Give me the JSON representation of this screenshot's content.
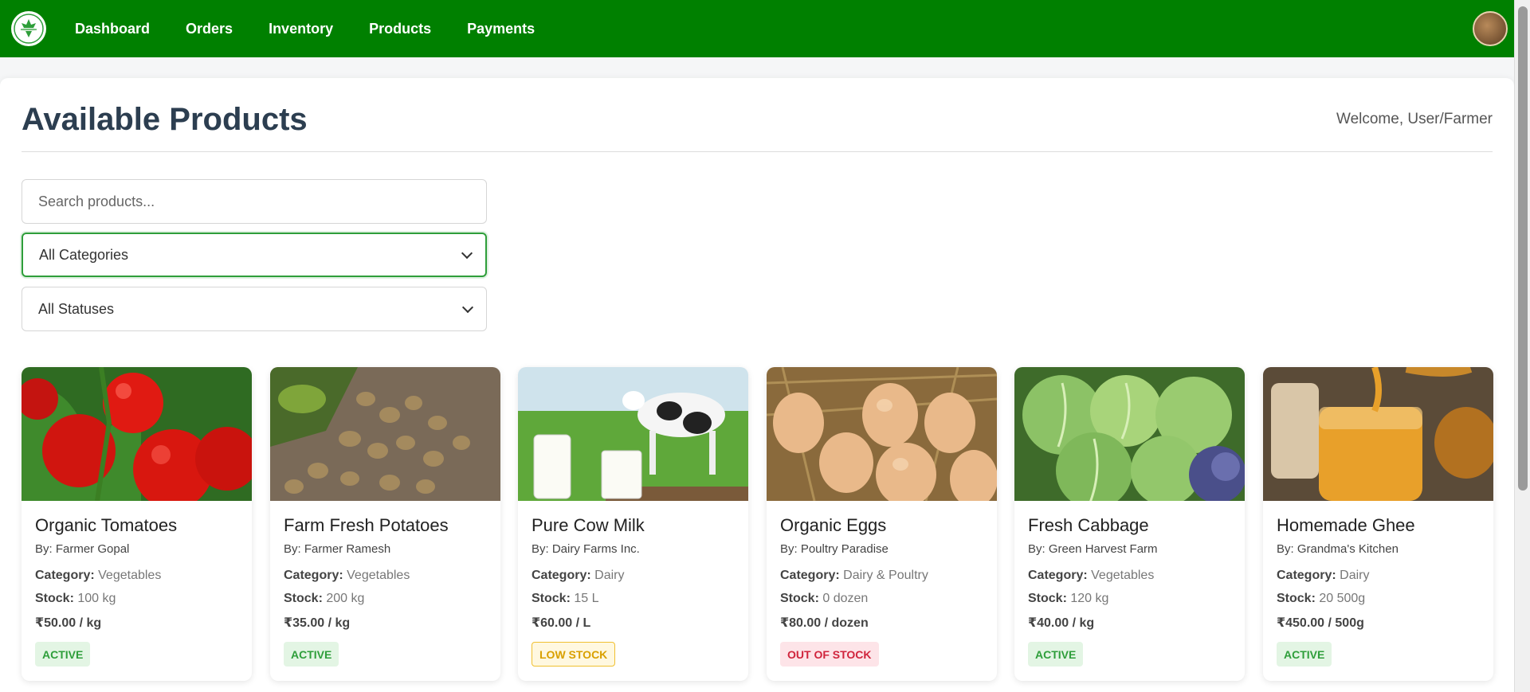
{
  "nav": {
    "items": [
      "Dashboard",
      "Orders",
      "Inventory",
      "Products",
      "Payments"
    ]
  },
  "header": {
    "title": "Available Products",
    "welcome": "Welcome, User/Farmer"
  },
  "filters": {
    "search_placeholder": "Search products...",
    "category_selected": "All Categories",
    "status_selected": "All Statuses"
  },
  "labels": {
    "category": "Category:",
    "stock": "Stock:"
  },
  "products": [
    {
      "name": "Organic Tomatoes",
      "by": "By: Farmer Gopal",
      "category": "Vegetables",
      "stock": "100 kg",
      "price": "₹50.00 / kg",
      "status": "ACTIVE"
    },
    {
      "name": "Farm Fresh Potatoes",
      "by": "By: Farmer Ramesh",
      "category": "Vegetables",
      "stock": "200 kg",
      "price": "₹35.00 / kg",
      "status": "ACTIVE"
    },
    {
      "name": "Pure Cow Milk",
      "by": "By: Dairy Farms Inc.",
      "category": "Dairy",
      "stock": "15 L",
      "price": "₹60.00 / L",
      "status": "LOW STOCK"
    },
    {
      "name": "Organic Eggs",
      "by": "By: Poultry Paradise",
      "category": "Dairy & Poultry",
      "stock": "0 dozen",
      "price": "₹80.00 / dozen",
      "status": "OUT OF STOCK"
    },
    {
      "name": "Fresh Cabbage",
      "by": "By: Green Harvest Farm",
      "category": "Vegetables",
      "stock": "120 kg",
      "price": "₹40.00 / kg",
      "status": "ACTIVE"
    },
    {
      "name": "Homemade Ghee",
      "by": "By: Grandma's Kitchen",
      "category": "Dairy",
      "stock": "20 500g",
      "price": "₹450.00 / 500g",
      "status": "ACTIVE"
    }
  ],
  "colors": {
    "nav_bg": "#008000",
    "active": "#2e9e3a",
    "low_stock": "#d9a000",
    "out_of_stock": "#d0243c"
  }
}
